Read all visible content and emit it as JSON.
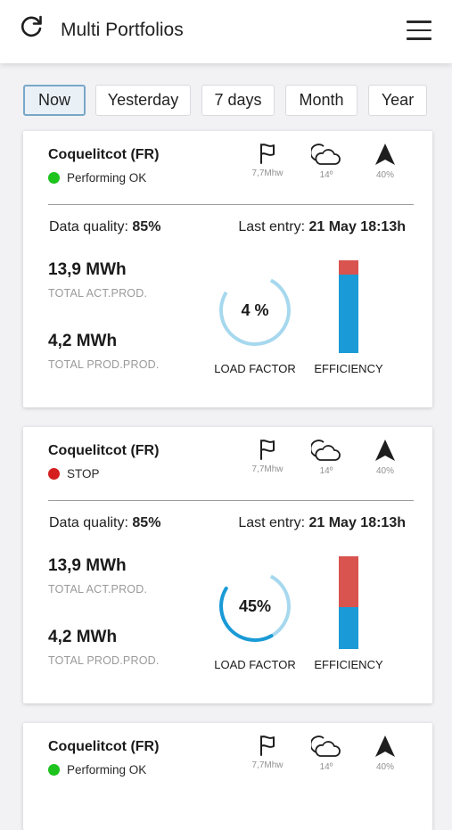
{
  "header": {
    "title": "Multi Portfolios",
    "refresh_icon": "refresh-icon",
    "menu_icon": "hamburger-menu-icon"
  },
  "tabs": [
    {
      "label": "Now",
      "active": true
    },
    {
      "label": "Yesterday",
      "active": false
    },
    {
      "label": "7 days",
      "active": false
    },
    {
      "label": "Month",
      "active": false
    },
    {
      "label": "Year",
      "active": false
    }
  ],
  "colors": {
    "ok": "#1ec31e",
    "stop": "#d51f1f",
    "gauge": "#1a9ad6",
    "gauge_light": "#a6d8ee",
    "bar_top": "#d9534f",
    "bar_fill": "#1a9ad6"
  },
  "cards": [
    {
      "name": "Coquelitcot (FR)",
      "status": "Performing OK",
      "status_type": "ok",
      "weather": {
        "power": "7,7Mhw",
        "temp": "14º",
        "wind": "40%"
      },
      "data_quality_label": "Data quality:",
      "data_quality": "85%",
      "last_entry_label": "Last entry:",
      "last_entry": "21 May 18:13h",
      "total_act_value": "13,9 MWh",
      "total_act_label": "TOTAL ACT.PROD.",
      "total_prod_value": "4,2 MWh",
      "total_prod_label": "TOTAL PROD.PROD.",
      "load_factor_value": "4 %",
      "load_factor_fraction": 0.04,
      "load_factor_label": "LOAD FACTOR",
      "efficiency_fraction": 0.85,
      "efficiency_label": "EFFICIENCY"
    },
    {
      "name": "Coquelitcot (FR)",
      "status": "STOP",
      "status_type": "stop",
      "weather": {
        "power": "7,7Mhw",
        "temp": "14º",
        "wind": "40%"
      },
      "data_quality_label": "Data quality:",
      "data_quality": "85%",
      "last_entry_label": "Last entry:",
      "last_entry": "21 May 18:13h",
      "total_act_value": "13,9 MWh",
      "total_act_label": "TOTAL ACT.PROD.",
      "total_prod_value": "4,2 MWh",
      "total_prod_label": "TOTAL PROD.PROD.",
      "load_factor_value": "45%",
      "load_factor_fraction": 0.45,
      "load_factor_label": "LOAD FACTOR",
      "efficiency_fraction": 0.45,
      "efficiency_label": "EFFICIENCY"
    },
    {
      "name": "Coquelitcot (FR)",
      "status": "Performing OK",
      "status_type": "ok",
      "weather": {
        "power": "7,7Mhw",
        "temp": "14º",
        "wind": "40%"
      }
    }
  ]
}
